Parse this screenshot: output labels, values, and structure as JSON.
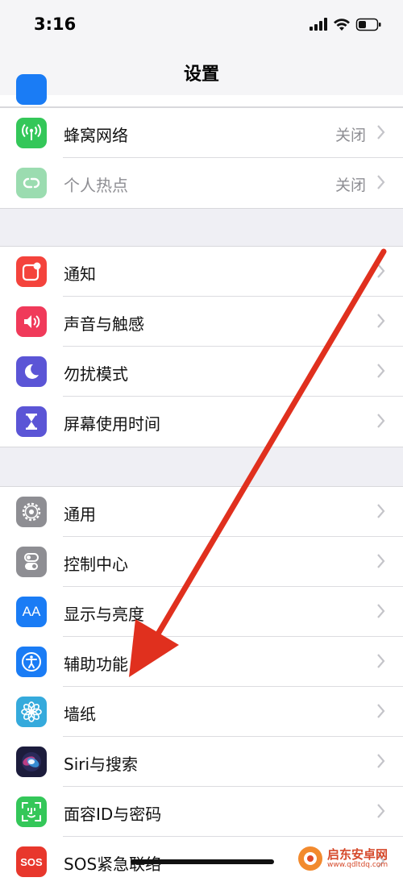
{
  "status_bar": {
    "time": "3:16"
  },
  "nav": {
    "title": "设置"
  },
  "groups": [
    {
      "rows": [
        {
          "label": "蜂窝网络",
          "value": "关闭",
          "icon": "cellular-antenna-icon",
          "color": "#34c759"
        },
        {
          "label": "个人热点",
          "value": "关闭",
          "icon": "hotspot-chain-icon",
          "color": "#9bdcb0"
        }
      ]
    },
    {
      "rows": [
        {
          "label": "通知",
          "icon": "notifications-icon",
          "color": "#f4433c"
        },
        {
          "label": "声音与触感",
          "icon": "speaker-icon",
          "color": "#f03a5a"
        },
        {
          "label": "勿扰模式",
          "icon": "moon-icon",
          "color": "#5b55d6"
        },
        {
          "label": "屏幕使用时间",
          "icon": "hourglass-icon",
          "color": "#5b55d6"
        }
      ]
    },
    {
      "rows": [
        {
          "label": "通用",
          "icon": "gear-icon",
          "color": "#8e8e93"
        },
        {
          "label": "控制中心",
          "icon": "toggles-icon",
          "color": "#8e8e93"
        },
        {
          "label": "显示与亮度",
          "icon": "text-size-icon",
          "color": "#1a7cf5"
        },
        {
          "label": "辅助功能",
          "icon": "accessibility-icon",
          "color": "#1a7cf5"
        },
        {
          "label": "墙纸",
          "icon": "flower-icon",
          "color": "#35aadc"
        },
        {
          "label": "Siri与搜索",
          "icon": "siri-icon",
          "color": "#1c1c3c"
        },
        {
          "label": "面容ID与密码",
          "icon": "face-id-icon",
          "color": "#34c759"
        },
        {
          "label": "SOS紧急联络",
          "icon": "sos-icon",
          "color": "#e8372c"
        }
      ]
    }
  ],
  "icon_text": {
    "display": "AA",
    "sos": "SOS"
  },
  "watermark": {
    "name": "启东安卓网",
    "url": "www.qdltdq.com"
  },
  "accent": {
    "arrow": "#e0301e"
  }
}
